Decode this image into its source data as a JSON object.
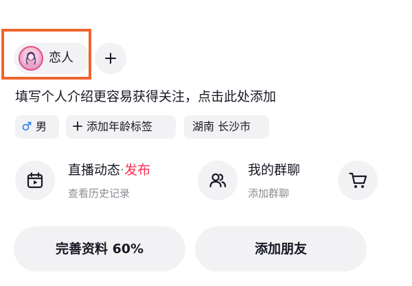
{
  "relation": {
    "label": "恋人",
    "add_icon": "plus-icon"
  },
  "bio": {
    "placeholder_text": "填写个人介绍更容易获得关注，点击此处添加"
  },
  "tags": {
    "gender": {
      "icon": "male-icon",
      "label": "男"
    },
    "age": {
      "icon": "plus-icon",
      "label": "添加年龄标签"
    },
    "location": {
      "label": "湖南 长沙市"
    }
  },
  "features": {
    "live": {
      "icon": "calendar-play-icon",
      "title": "直播动态",
      "separator": "·",
      "action": "发布",
      "subtitle": "查看历史记录"
    },
    "group": {
      "icon": "group-users-icon",
      "title": "我的群聊",
      "subtitle": "添加群聊"
    },
    "shop": {
      "icon": "shopping-cart-icon"
    }
  },
  "buttons": {
    "complete_profile": "完善资料 60%",
    "add_friends": "添加朋友"
  },
  "colors": {
    "accent_red": "#fe2c55",
    "highlight_orange": "#f0642e",
    "chip_bg": "#f2f2f4",
    "gender_blue": "#3b83f6",
    "avatar_border": "#e54a8c"
  }
}
